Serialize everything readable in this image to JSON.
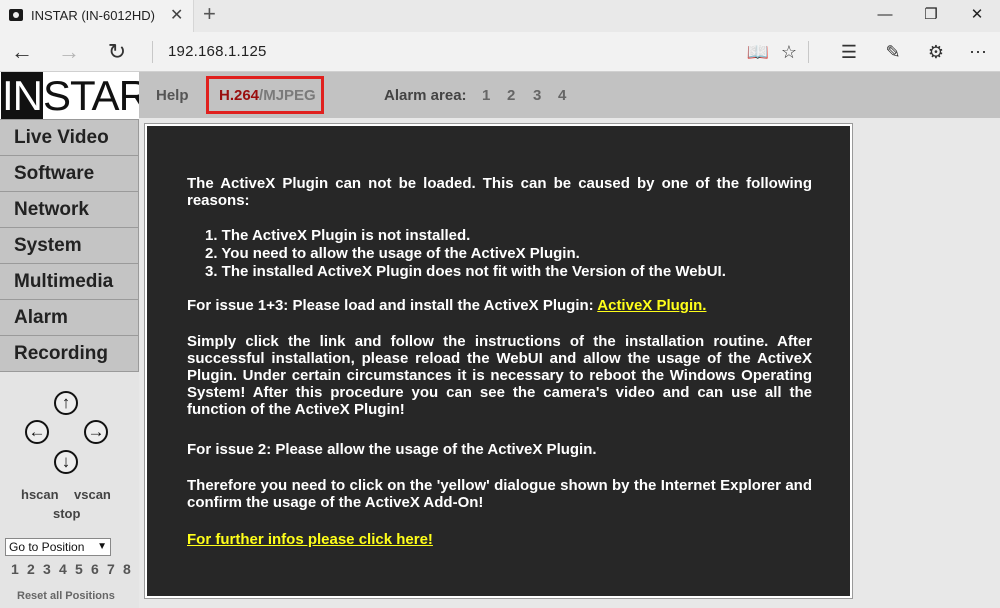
{
  "browser": {
    "tab_title": "INSTAR (IN-6012HD)",
    "tab_close": "✕",
    "new_tab": "+",
    "address": "192.168.1.125",
    "window_controls": {
      "minimize": "—",
      "maximize": "❐",
      "close": "✕"
    },
    "icons": {
      "back": "←",
      "forward": "→",
      "refresh": "↻",
      "reading_view": "📖",
      "favorite": "☆",
      "hub": "☰",
      "web_note": "✎",
      "share": "⚙",
      "more": "⋯"
    }
  },
  "logo": {
    "part1": "IN",
    "part2": "STAR"
  },
  "topnav": {
    "help": "Help",
    "codec_a": "H.264",
    "codec_sep": "/",
    "codec_b": "MJPEG",
    "alarm_label": "Alarm area:",
    "alarm_areas": [
      "1",
      "2",
      "3",
      "4"
    ]
  },
  "sidebar": {
    "menu": [
      "Live Video",
      "Software",
      "Network",
      "System",
      "Multimedia",
      "Alarm",
      "Recording"
    ],
    "ptz": {
      "up": "↑",
      "left": "←",
      "right": "→",
      "down": "↓"
    },
    "hscan": "hscan",
    "vscan": "vscan",
    "stop": "stop",
    "goto_position": "Go to Position",
    "positions": [
      "1",
      "2",
      "3",
      "4",
      "5",
      "6",
      "7",
      "8"
    ],
    "reset_positions": "Reset all Positions"
  },
  "message": {
    "intro": "The ActiveX Plugin can not be loaded. This can be caused by one of the following reasons:",
    "reasons": [
      "1.  The ActiveX Plugin is not installed.",
      "2.  You need to allow the usage of the ActiveX Plugin.",
      "3.  The installed ActiveX Plugin does not fit with the Version of the WebUI."
    ],
    "issue13_prefix": "For issue 1+3: Please load and install the ActiveX Plugin: ",
    "issue13_link": "ActiveX Plugin.",
    "instructions": "Simply click the link and follow the instructions of the installation routine. After successful installation, please reload the WebUI and allow the usage of the ActiveX Plugin. Under certain circumstances it is necessary to reboot the Windows Operating System! After this procedure you can see the camera's video and can use all the function of the ActiveX Plugin!",
    "issue2": "For issue 2: Please allow the usage of the ActiveX Plugin.",
    "therefore": "Therefore you need to click on the 'yellow' dialogue shown by the Internet Explorer and confirm the usage of the ActiveX Add-On!",
    "further_link": "For further infos please click here!"
  },
  "colors": {
    "codec_highlight_border": "#e0201e",
    "codec_active": "#9a0e0e",
    "link": "#ffff1a",
    "message_bg": "#272727"
  }
}
